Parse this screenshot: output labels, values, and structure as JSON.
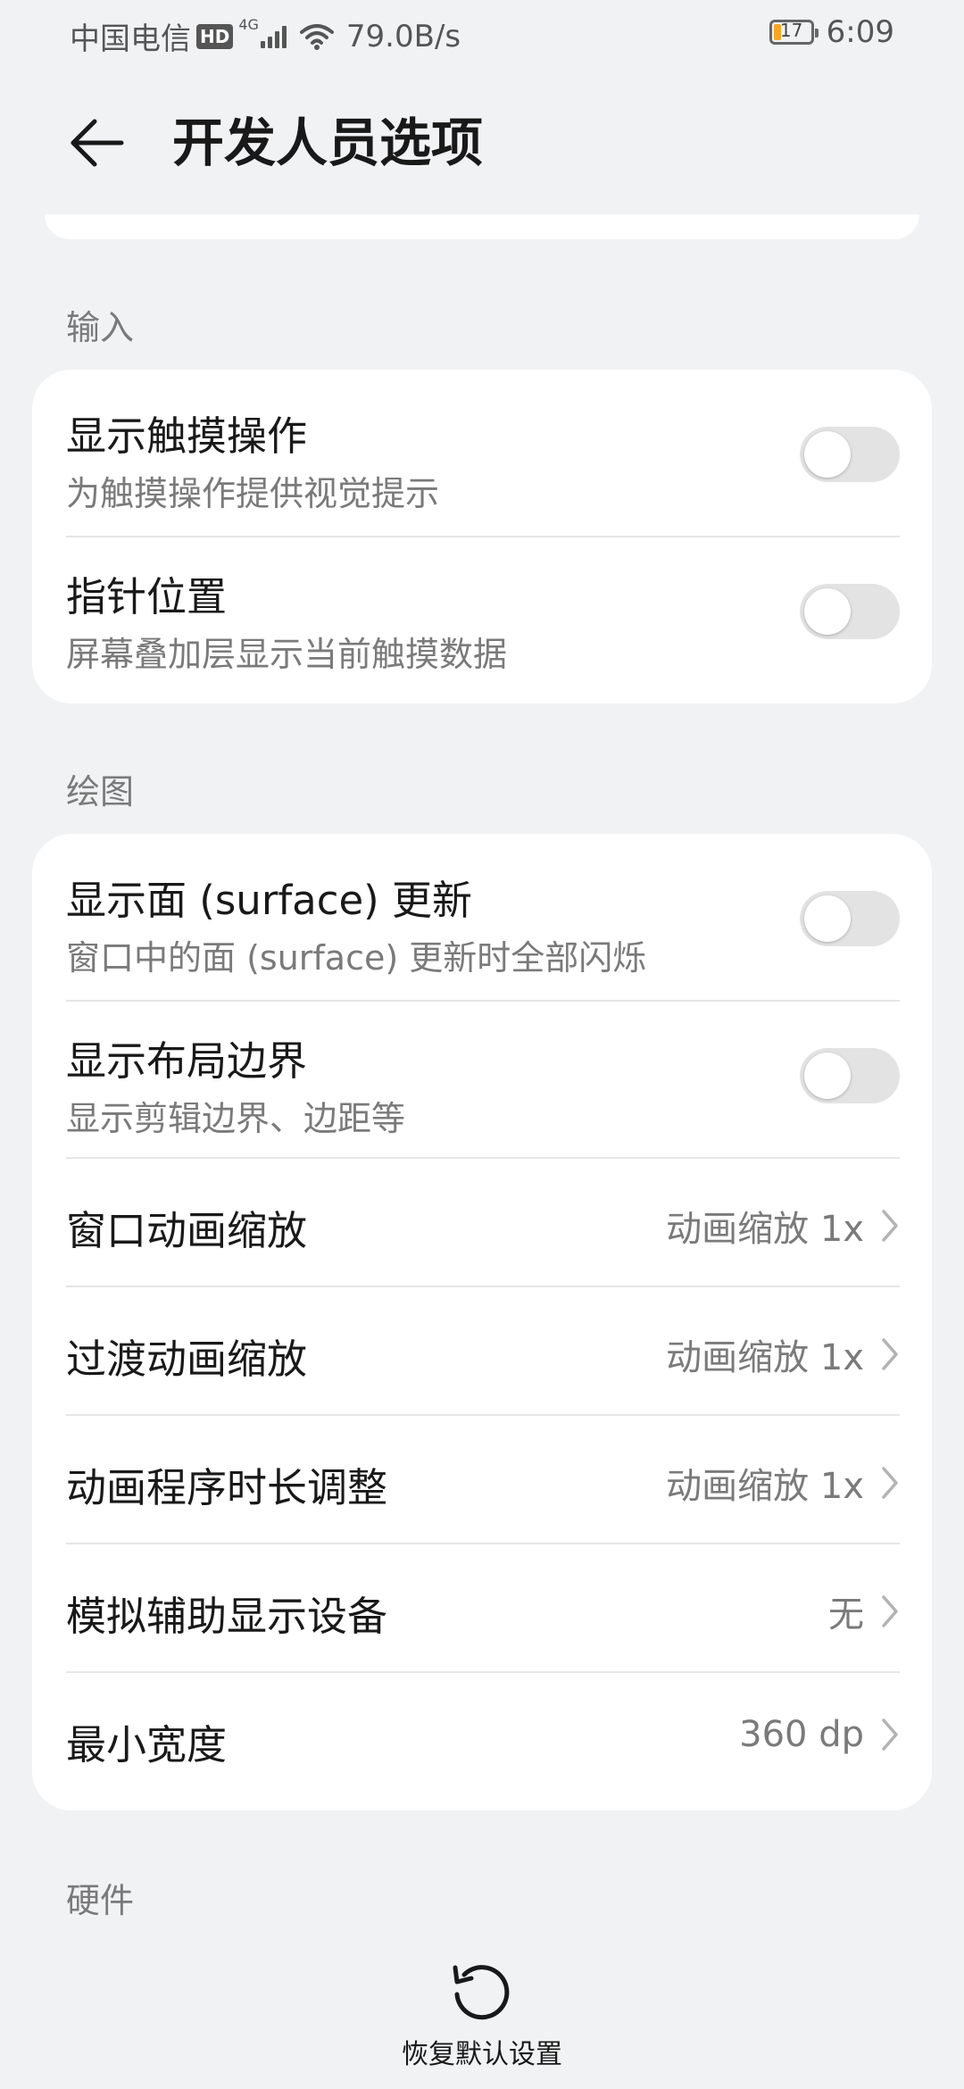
{
  "status_bar": {
    "carrier": "中国电信",
    "hd": "HD",
    "network": "4G",
    "speed": "79.0B/s",
    "battery": "17",
    "time": "6:09"
  },
  "header": {
    "title": "开发人员选项"
  },
  "sections": {
    "input": {
      "label": "输入",
      "items": [
        {
          "title": "显示触摸操作",
          "subtitle": "为触摸操作提供视觉提示",
          "enabled": false
        },
        {
          "title": "指针位置",
          "subtitle": "屏幕叠加层显示当前触摸数据",
          "enabled": false
        }
      ]
    },
    "drawing": {
      "label": "绘图",
      "toggles": [
        {
          "title": "显示面 (surface) 更新",
          "subtitle": "窗口中的面 (surface) 更新时全部闪烁",
          "enabled": false
        },
        {
          "title": "显示布局边界",
          "subtitle": "显示剪辑边界、边距等",
          "enabled": false
        }
      ],
      "links": [
        {
          "title": "窗口动画缩放",
          "value": "动画缩放 1x"
        },
        {
          "title": "过渡动画缩放",
          "value": "动画缩放 1x"
        },
        {
          "title": "动画程序时长调整",
          "value": "动画缩放 1x"
        },
        {
          "title": "模拟辅助显示设备",
          "value": "无"
        },
        {
          "title": "最小宽度",
          "value": "360 dp"
        }
      ]
    },
    "hardware": {
      "label": "硬件"
    }
  },
  "footer": {
    "restore_label": "恢复默认设置"
  },
  "colors": {
    "background": "#f1f2f4",
    "card": "#ffffff",
    "toggle_off": "#e3e3e3",
    "battery_low": "#f5a623"
  }
}
